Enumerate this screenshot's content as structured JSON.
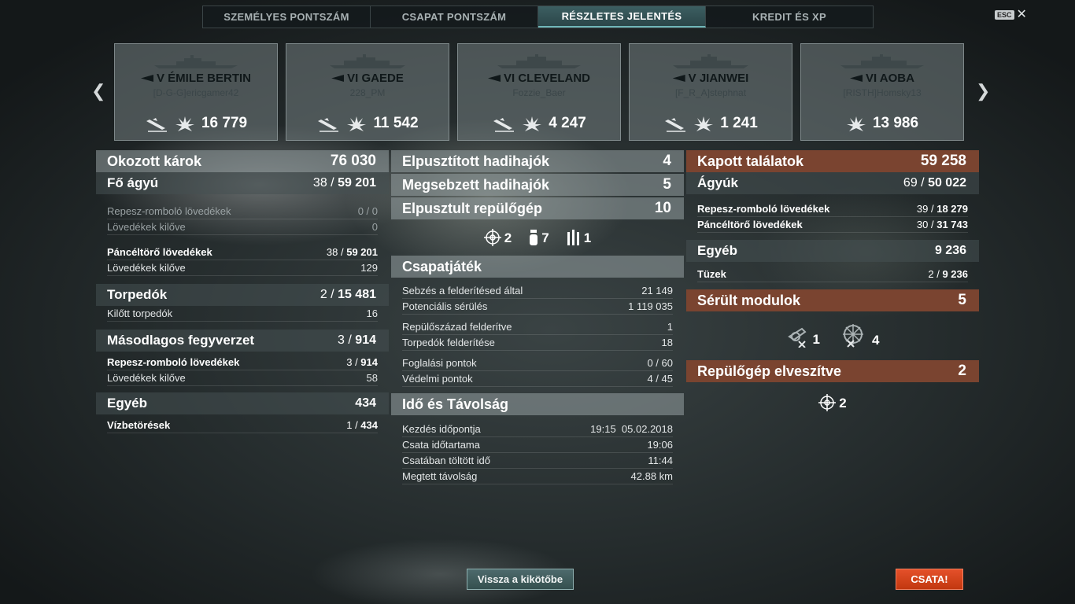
{
  "tabs": [
    "SZEMÉLYES PONTSZÁM",
    "CSAPAT PONTSZÁM",
    "RÉSZLETES JELENTÉS",
    "KREDIT ÉS XP"
  ],
  "esc": {
    "key": "ESC"
  },
  "ships": [
    {
      "name": "V ÉMILE BERTIN",
      "player": "[D-G-G]ericgamer42",
      "score": "16 779"
    },
    {
      "name": "VI GAEDE",
      "player": "228_PM",
      "score": "11 542"
    },
    {
      "name": "VI CLEVELAND",
      "player": "Fozzie_Baer",
      "score": "4 247"
    },
    {
      "name": "V JIANWEI",
      "player": "[F_R_A]stephnat",
      "score": "1 241"
    },
    {
      "name": "VI AOBA",
      "player": "[RISTH]Homsky13",
      "score": "13 986"
    }
  ],
  "left": {
    "damage": {
      "label": "Okozott károk",
      "value": "76 030"
    },
    "main": {
      "label": "Fő ágyú",
      "hits": "38",
      "total": "59 201"
    },
    "he": {
      "label": "Repesz-romboló lövedékek",
      "value": "0 / 0"
    },
    "he_fired": {
      "label": "Lövedékek kilőve",
      "value": "0"
    },
    "ap": {
      "label": "Páncéltörő lövedékek",
      "hits": "38",
      "total": "59 201"
    },
    "ap_fired": {
      "label": "Lövedékek kilőve",
      "value": "129"
    },
    "torp": {
      "label": "Torpedók",
      "hits": "2",
      "total": "15 481"
    },
    "torp_fired": {
      "label": "Kilőtt torpedók",
      "value": "16"
    },
    "sec": {
      "label": "Másodlagos fegyverzet",
      "hits": "3",
      "total": "914"
    },
    "sec_he": {
      "label": "Repesz-romboló lövedékek",
      "hits": "3",
      "total": "914"
    },
    "sec_fired": {
      "label": "Lövedékek kilőve",
      "value": "58"
    },
    "other": {
      "label": "Egyéb",
      "value": "434"
    },
    "flood": {
      "label": "Vízbetörések",
      "hits": "1",
      "total": "434"
    }
  },
  "middle": {
    "destroyed": {
      "label": "Elpusztított hadihajók",
      "value": "4"
    },
    "damaged": {
      "label": "Megsebzett hadihajók",
      "value": "5"
    },
    "planes": {
      "label": "Elpusztult repülőgép",
      "value": "10"
    },
    "plane_icons": [
      {
        "icon": "crosshair-icon",
        "value": "2"
      },
      {
        "icon": "bomb-icon",
        "value": "7"
      },
      {
        "icon": "rockets-icon",
        "value": "1"
      }
    ],
    "team": {
      "label": "Csapatjáték"
    },
    "spot_dmg": {
      "label": "Sebzés a felderítésed által",
      "value": "21 149"
    },
    "potential": {
      "label": "Potenciális sérülés",
      "value": "1 119 035"
    },
    "squad": {
      "label": "Repülőszázad felderítve",
      "value": "1"
    },
    "torp_spot": {
      "label": "Torpedók felderítése",
      "value": "18"
    },
    "capture": {
      "label": "Foglalási pontok",
      "value": "0 / 60"
    },
    "defense": {
      "label": "Védelmi pontok",
      "value": "4 / 45"
    },
    "time": {
      "label": "Idő és Távolság"
    },
    "start": {
      "label": "Kezdés időpontja",
      "value": "19:15  05.02.2018"
    },
    "duration": {
      "label": "Csata időtartama",
      "value": "19:06"
    },
    "in_battle": {
      "label": "Csatában töltött idő",
      "value": "11:44"
    },
    "distance": {
      "label": "Megtett távolság",
      "value": "42.88 km"
    }
  },
  "right": {
    "received": {
      "label": "Kapott találatok",
      "value": "59 258"
    },
    "guns": {
      "label": "Ágyúk",
      "hits": "69",
      "total": "50 022"
    },
    "he": {
      "label": "Repesz-romboló lövedékek",
      "hits": "39",
      "total": "18 279"
    },
    "ap": {
      "label": "Páncéltörő lövedékek",
      "hits": "30",
      "total": "31 743"
    },
    "other": {
      "label": "Egyéb",
      "value": "9 236"
    },
    "fires": {
      "label": "Tüzek",
      "hits": "2",
      "total": "9 236"
    },
    "modules": {
      "label": "Sérült modulok",
      "value": "5"
    },
    "module_icons": [
      {
        "icon": "turret-broken-icon",
        "value": "1"
      },
      {
        "icon": "rudder-broken-icon",
        "value": "4"
      }
    ],
    "planes_lost": {
      "label": "Repülőgép elveszítve",
      "value": "2"
    },
    "planes_lost_icon": {
      "icon": "crosshair-icon",
      "value": "2"
    }
  },
  "buttons": {
    "back": "Vissza a kikötőbe",
    "battle": "CSATA!"
  },
  "colors": {
    "red_header": "#7a4430",
    "battle_button": "#d4401a",
    "active_tab": "#3c5f62"
  }
}
